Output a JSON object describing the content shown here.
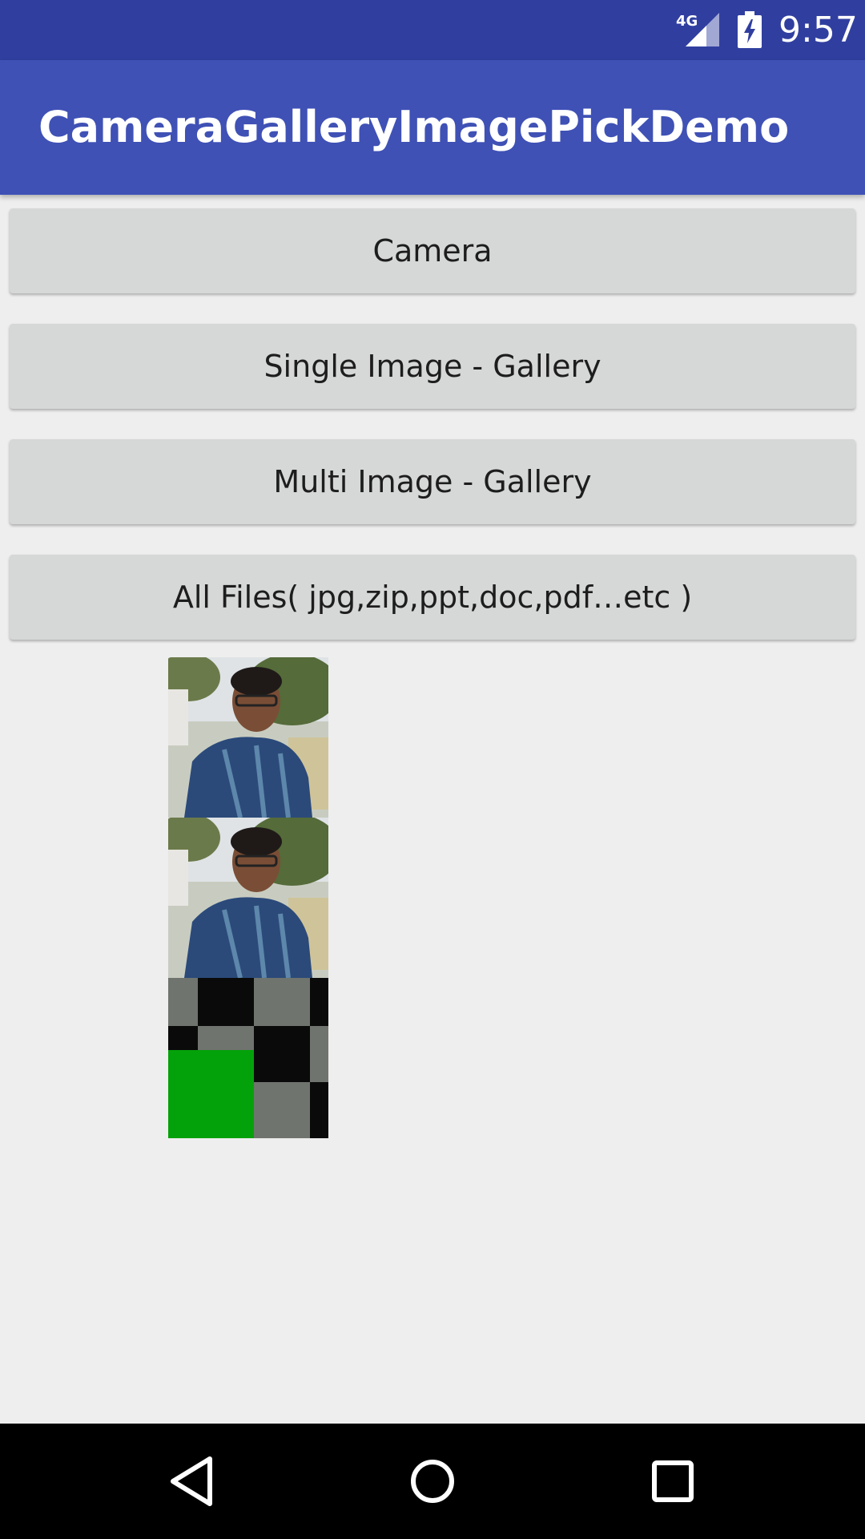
{
  "status_bar": {
    "network": "4G",
    "time": "9:57",
    "signal_icon": "signal-4g-icon",
    "battery_icon": "battery-charging-icon"
  },
  "app_bar": {
    "title": "CameraGalleryImagePickDemo"
  },
  "buttons": {
    "camera": "Camera",
    "single_gallery": "Single Image - Gallery",
    "multi_gallery": "Multi Image - Gallery",
    "all_files": "All Files( jpg,zip,ppt,doc,pdf…etc )"
  },
  "images": [
    {
      "kind": "photo"
    },
    {
      "kind": "photo"
    },
    {
      "kind": "checker-pattern"
    }
  ],
  "nav_bar": {
    "back_icon": "back-triangle-icon",
    "home_icon": "home-circle-icon",
    "recents_icon": "recents-square-icon"
  }
}
